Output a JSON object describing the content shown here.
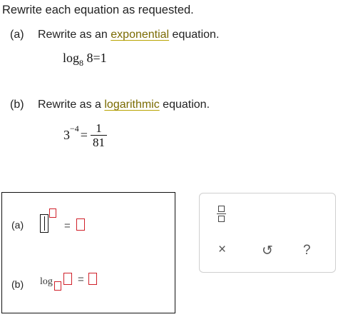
{
  "heading": "Rewrite each equation as requested.",
  "part_a": {
    "label": "(a)",
    "instruction_pre": "Rewrite as an ",
    "instruction_term": "exponential",
    "instruction_post": " equation.",
    "equation": {
      "log": "log",
      "base": "8",
      "arg": "8",
      "equals": "=",
      "rhs": "1"
    }
  },
  "part_b": {
    "label": "(b)",
    "instruction_pre": "Rewrite as a ",
    "instruction_term": "logarithmic",
    "instruction_post": " equation.",
    "equation": {
      "base": "3",
      "exponent": "−4",
      "equals": "=",
      "numerator": "1",
      "denominator": "81"
    }
  },
  "answer_area": {
    "a": {
      "label": "(a)",
      "equals": "="
    },
    "b": {
      "label": "(b)",
      "log": "log",
      "equals": "="
    }
  },
  "toolbar": {
    "fraction_icon": "fraction-icon",
    "clear_symbol": "×",
    "undo_symbol": "↺",
    "help_symbol": "?"
  }
}
